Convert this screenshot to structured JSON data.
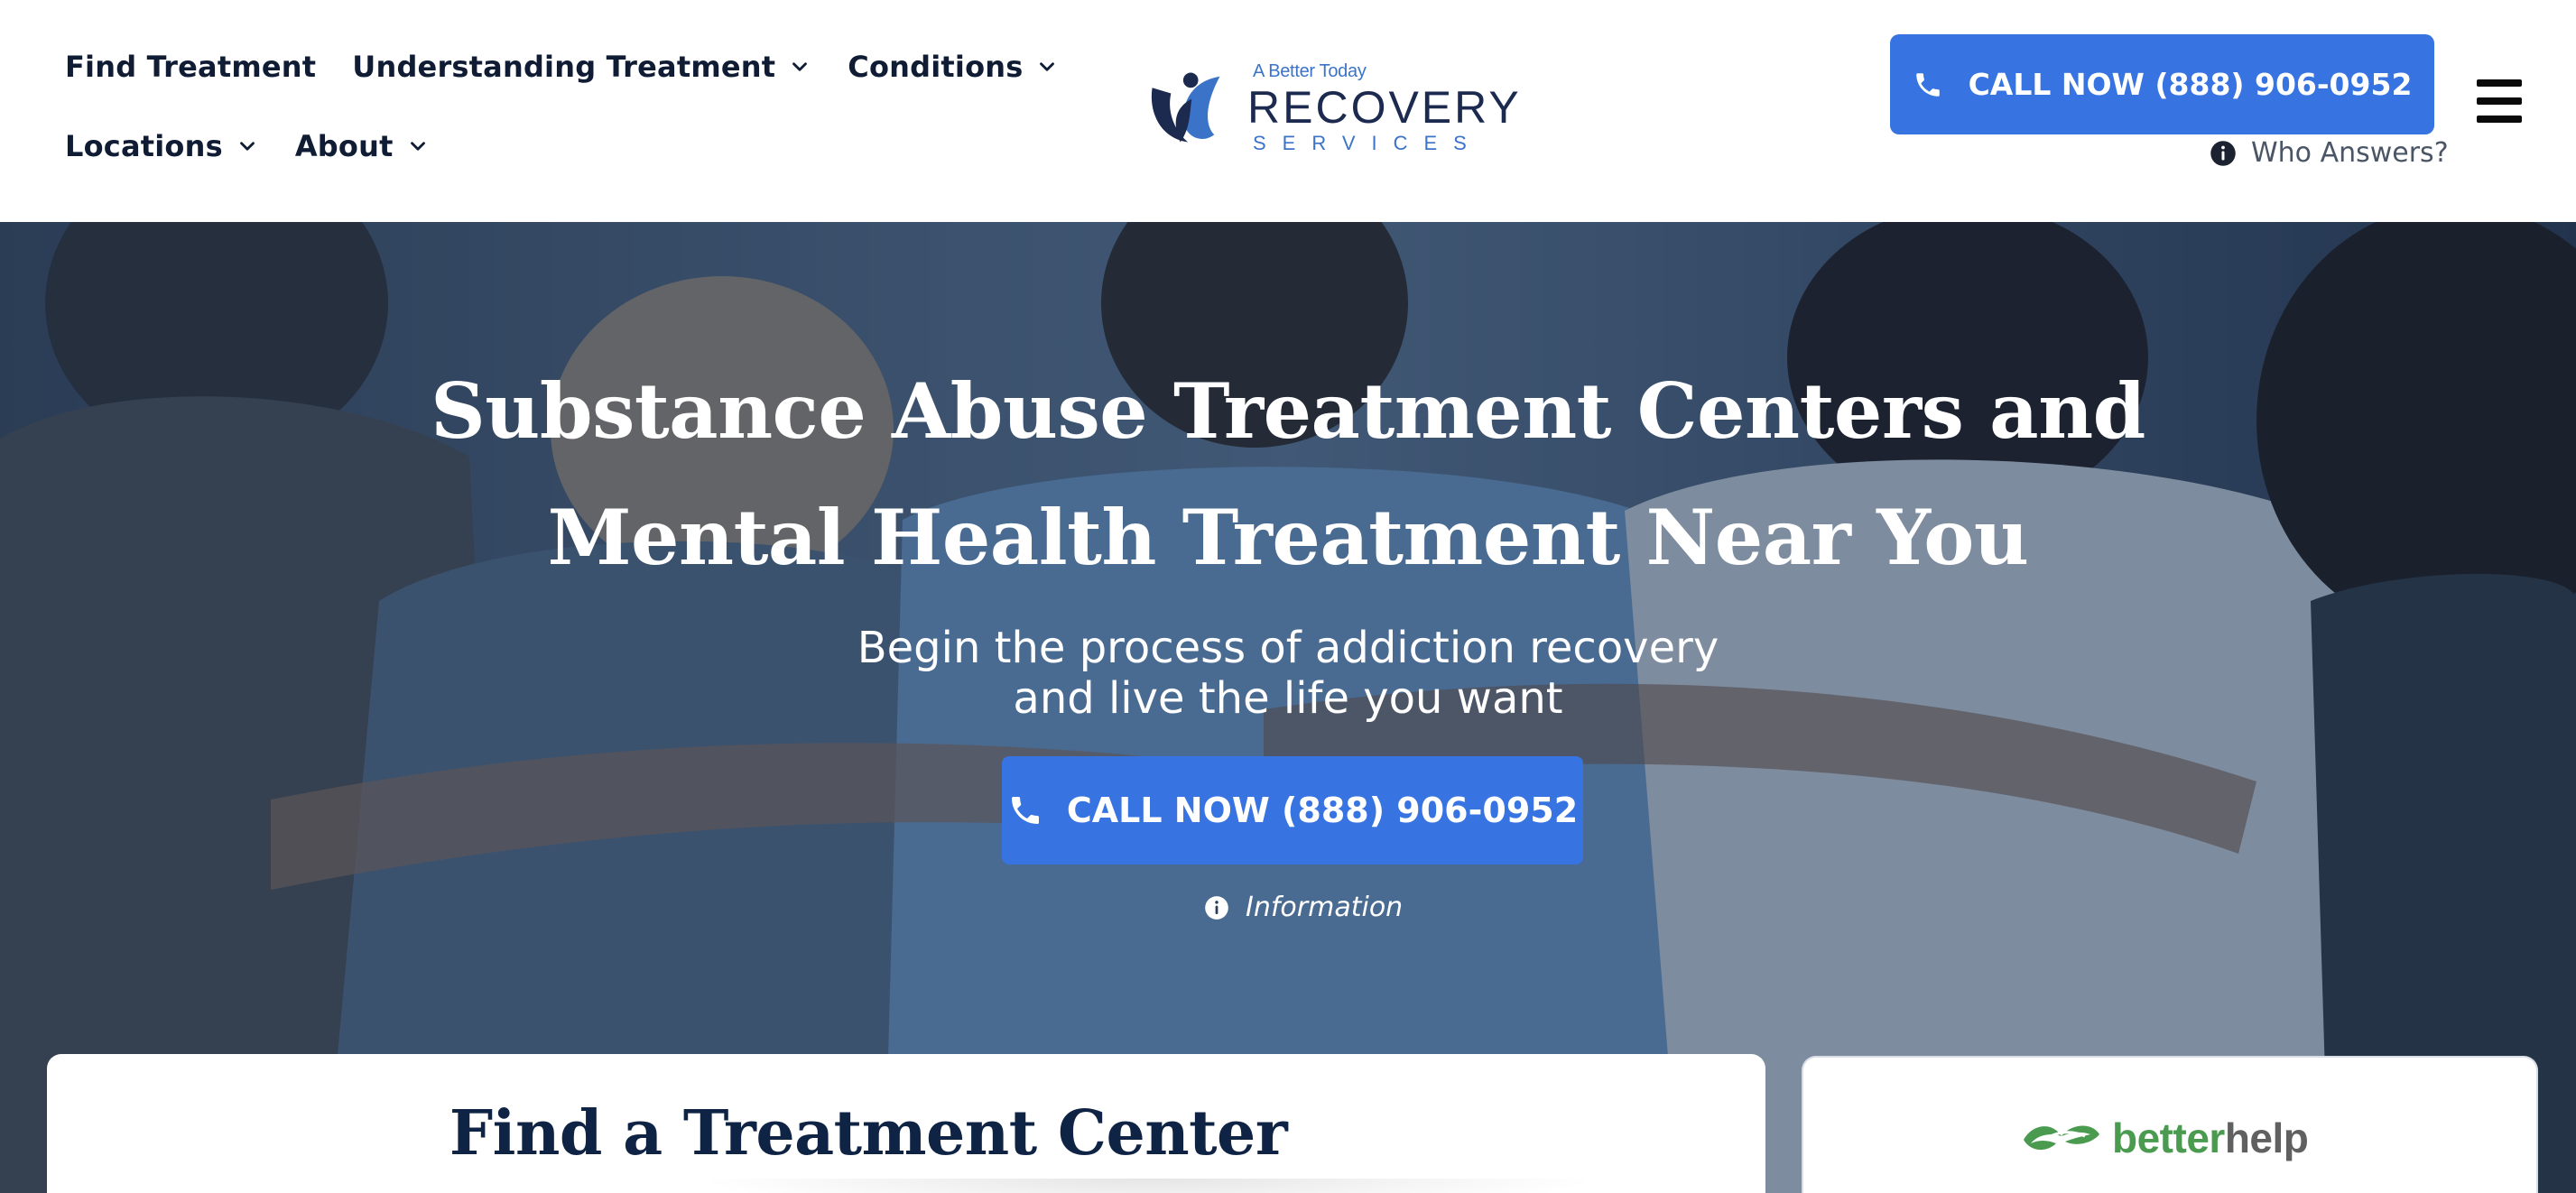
{
  "header": {
    "nav": {
      "row1": [
        {
          "label": "Find Treatment",
          "has_dropdown": false
        },
        {
          "label": "Understanding Treatment",
          "has_dropdown": true
        },
        {
          "label": "Conditions",
          "has_dropdown": true
        }
      ],
      "row2": [
        {
          "label": "Locations",
          "has_dropdown": true
        },
        {
          "label": "About",
          "has_dropdown": true
        }
      ]
    },
    "logo": {
      "tagline": "A Better Today",
      "main": "RECOVERY",
      "sub": "SERVICES",
      "colors": {
        "navy": "#1c2a4f",
        "blue": "#3b73c9"
      }
    },
    "cta_label": "CALL NOW (888) 906-0952",
    "who_answers": "Who Answers?",
    "menu_icon": "hamburger-menu-icon"
  },
  "hero": {
    "title": "Substance Abuse Treatment Centers and Mental Health Treatment Near You",
    "subtitle_line1": "Begin the process of addiction recovery",
    "subtitle_line2": "and live the life you want",
    "cta_label": "CALL NOW (888) 906-0952",
    "info_label": "Information"
  },
  "cards": {
    "find_title": "Find a Treatment Center",
    "partner_logo": {
      "better": "better",
      "help": "help",
      "colors": {
        "better": "#4a9b4f",
        "help": "#606060"
      }
    }
  },
  "colors": {
    "accent": "#3774e1",
    "nav_text": "#0f1c33",
    "heading": "#0f2344",
    "hero_overlay": "#182a48"
  }
}
